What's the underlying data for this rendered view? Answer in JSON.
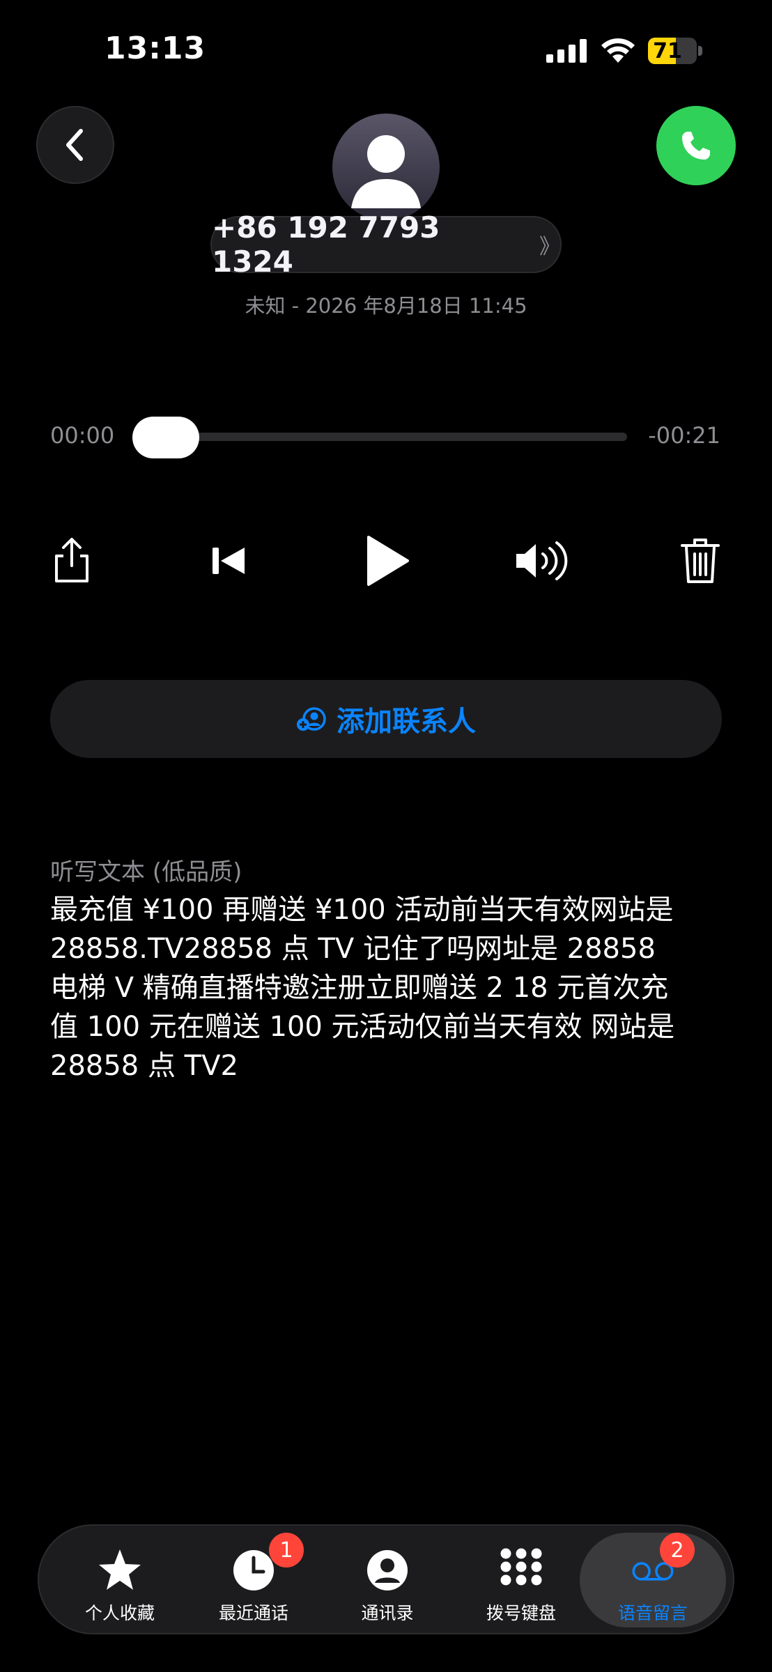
{
  "status": {
    "time": "13:13",
    "battery_level": "71",
    "battery_fraction": 0.71,
    "battery_color": "#ffd60a"
  },
  "header": {
    "phone_number": "+86 192 7793 1324",
    "number_chevron": "》",
    "meta": "未知 - 2026 年8月18日 11:45",
    "call_button_color": "#30d158"
  },
  "player": {
    "elapsed": "00:00",
    "remaining": "-00:21",
    "progress_fraction": 0.0,
    "controls": {
      "share_icon": "share-icon",
      "previous_icon": "skip-back-icon",
      "play_icon": "play-icon",
      "speaker_icon": "speaker-icon",
      "delete_icon": "trash-icon"
    }
  },
  "actions": {
    "add_contact_label": "添加联系人",
    "accent_color": "#0a84ff"
  },
  "transcript": {
    "title": "听写文本 (低品质)",
    "body": "最充值 ¥100 再赠送 ¥100 活动前当天有效网站是\n28858.TV28858 点 TV 记住了吗网址是 28858\n电梯 V 精确直播特邀注册立即赠送 2 18 元首次充\n值 100 元在赠送 100 元活动仅前当天有效 网站是\n28858 点 TV2"
  },
  "tabbar": {
    "tabs": [
      {
        "label": "个人收藏",
        "icon": "star-icon",
        "badge": ""
      },
      {
        "label": "最近通话",
        "icon": "clock-icon",
        "badge": "1"
      },
      {
        "label": "通讯录",
        "icon": "person-icon",
        "badge": ""
      },
      {
        "label": "拨号键盘",
        "icon": "keypad-icon",
        "badge": ""
      },
      {
        "label": "语音留言",
        "icon": "voicemail-icon",
        "badge": "2",
        "active": true
      }
    ]
  }
}
